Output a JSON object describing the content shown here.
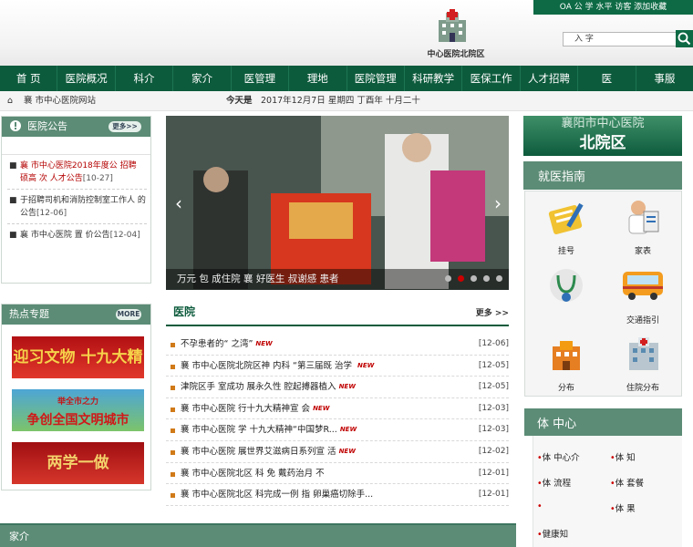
{
  "toplinks": "OA 公  学  水平  访客  添加收藏",
  "site_name": "中心医院北院区",
  "search": {
    "placeholder": "入 字"
  },
  "nav": [
    "首 页",
    "医院概况",
    "科介",
    "家介",
    "医管理",
    "理地",
    "医院管理",
    "科研教学",
    "医保工作",
    "人才招聘",
    "医",
    "事服"
  ],
  "infobar": {
    "left": "襄 市中心医院网站",
    "today_label": "今天是",
    "date": "2017年12月7日 星期四 丁酉年 十月二十"
  },
  "notice": {
    "title": "医院公告",
    "more": "更多>>",
    "items": [
      {
        "text": "襄 市中心医院2018年度公 招聘 硕高 次  人才公告",
        "date": "[10-27]",
        "red": true
      },
      {
        "text": "于招聘司机和消防控制室工作人 的公告",
        "date": "[12-06]",
        "red": false
      },
      {
        "text": "襄 市中心医院     置 价公告",
        "date": "[12-04]",
        "red": false
      }
    ]
  },
  "hot": {
    "title": "热点专题",
    "more": "MORE",
    "banners": [
      "迎习文物 十九大精神",
      "争创全国文明城市",
      "两学一做"
    ],
    "banner2_sub": "举全市之力"
  },
  "slider": {
    "caption": "万元 包 成住院 襄 好医生 叔谢感 患者"
  },
  "news": {
    "title": "医院",
    "more": "更多 >>",
    "new_tag": "NEW",
    "items": [
      {
        "text": "不孕患者的“ 之湾”",
        "date": "[12-06]",
        "isnew": true
      },
      {
        "text": "襄 市中心医院北院区神 内科 “第三届既 治学 ",
        "date": "[12-05]",
        "isnew": true
      },
      {
        "text": "津院区手 室成功 展永久性 腔起搏器植入",
        "date": "[12-05]",
        "isnew": true
      },
      {
        "text": "襄 市中心医院 行十九大精神宣 会",
        "date": "[12-03]",
        "isnew": true
      },
      {
        "text": "襄 市中心医院 学  十九大精神“中国梦R...",
        "date": "[12-03]",
        "isnew": true
      },
      {
        "text": "襄 市中心医院 展世界艾滋病日系列宣 活",
        "date": "[12-02]",
        "isnew": true
      },
      {
        "text": "襄 市中心医院北区 科 免 戴药治月 不",
        "date": "[12-01]",
        "isnew": false
      },
      {
        "text": "襄 市中心医院北区  科完成一例 指 卵巢癌切除手...",
        "date": "[12-01]",
        "isnew": false
      }
    ]
  },
  "experts_bar": {
    "title": "家介"
  },
  "district": {
    "line1": "襄阳市中心医院",
    "line2": "北院区"
  },
  "guide": {
    "title": "就医指南",
    "items": [
      "挂号",
      "家表",
      "",
      "交通指引",
      "分布",
      "住院分布"
    ]
  },
  "tijian": {
    "title": "体 中心",
    "items": [
      "体 中心介",
      "体 知",
      "体 流程",
      "体 套餐",
      "",
      "体 果",
      "健康知"
    ]
  },
  "colors": {
    "brand_green": "#0d5b3d",
    "panel_green": "#5c8c76",
    "red": "#b40000",
    "orange": "#d07a18"
  }
}
